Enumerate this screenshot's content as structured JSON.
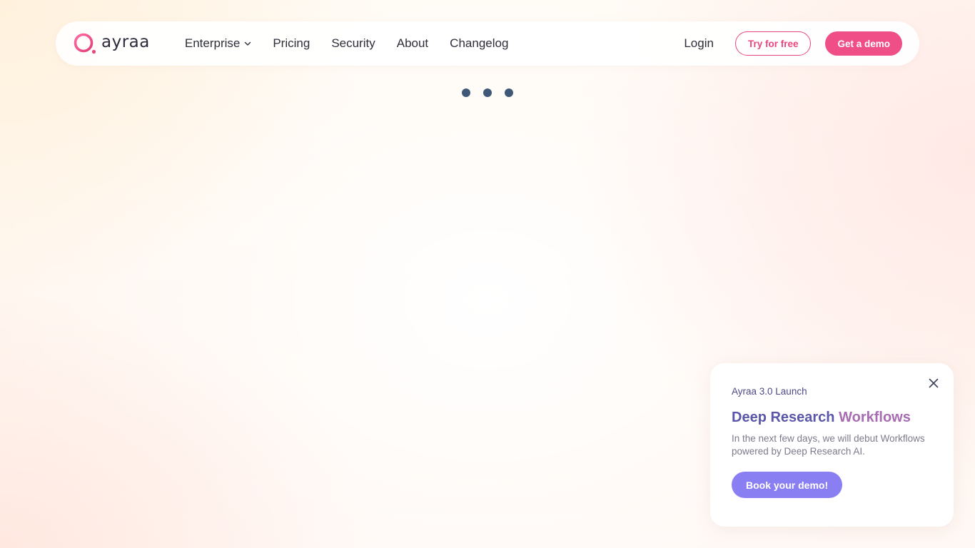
{
  "brand": {
    "name": "ayraa",
    "logo_icon": "ring-logo-icon",
    "accent_color": "#ef4f86"
  },
  "nav": {
    "links": [
      {
        "label": "Enterprise",
        "has_dropdown": true
      },
      {
        "label": "Pricing"
      },
      {
        "label": "Security"
      },
      {
        "label": "About"
      },
      {
        "label": "Changelog"
      }
    ],
    "login_label": "Login",
    "try_free_label": "Try for free",
    "demo_label": "Get a demo"
  },
  "loader": {
    "icon": "loading-dots",
    "dot_color": "#3f5877"
  },
  "popup": {
    "eyebrow": "Ayraa 3.0 Launch",
    "title_part1": "Deep Research",
    "title_part2": "Workflows",
    "body": "In the next few days, we will debut Workflows powered by Deep Research AI.",
    "button_label": "Book your demo!",
    "close_icon": "close-icon",
    "button_color": "#8a7ff2"
  }
}
